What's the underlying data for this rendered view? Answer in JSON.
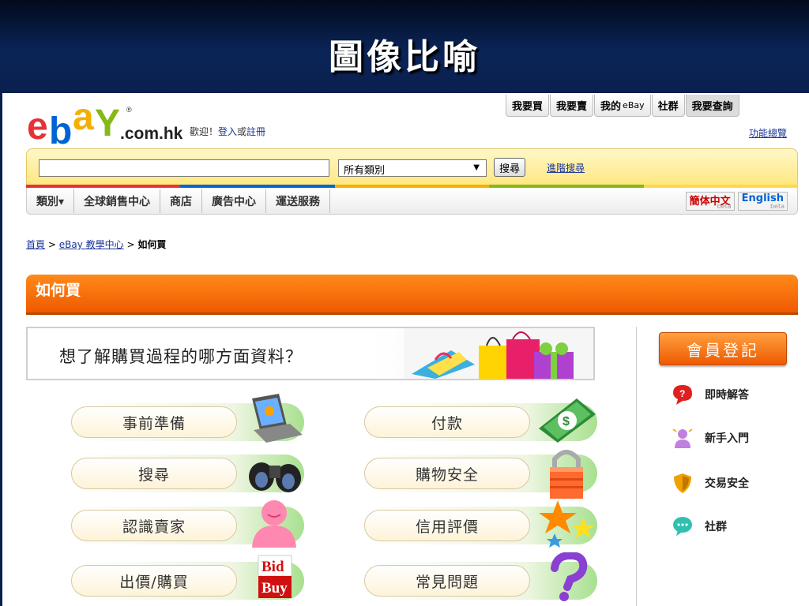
{
  "slide": {
    "title": "圖像比喻"
  },
  "header": {
    "logo_text": "ebay",
    "logo_domain": ".com.hk",
    "welcome_prefix": "歡迎！",
    "sign_in": "登入",
    "or": "或",
    "register": "註冊",
    "feature_link": "功能總覽",
    "top_tabs": [
      {
        "label": "我要買"
      },
      {
        "label": "我要賣"
      },
      {
        "label": "我的",
        "suffix": "eBay"
      },
      {
        "label": "社群"
      },
      {
        "label": "我要查詢"
      }
    ]
  },
  "search": {
    "input_value": "",
    "category": "所有類別",
    "search_button": "搜尋",
    "advanced_link": "進階搜尋"
  },
  "nav": {
    "items": [
      "類別▾",
      "全球銷售中心",
      "商店",
      "廣告中心",
      "運送服務"
    ],
    "lang_simplified": "簡体中文",
    "lang_english": "English",
    "beta": "beta"
  },
  "breadcrumb": {
    "home": "首頁",
    "learning": "eBay 教學中心",
    "current": "如何買",
    "sep": ">"
  },
  "section": {
    "title": "如何買"
  },
  "question": {
    "text": "想了解購買過程的哪方面資料？"
  },
  "topics": [
    {
      "label": "事前準備",
      "icon": "laptop-icon"
    },
    {
      "label": "付款",
      "icon": "money-icon"
    },
    {
      "label": "搜尋",
      "icon": "binoculars-icon"
    },
    {
      "label": "購物安全",
      "icon": "lock-icon"
    },
    {
      "label": "認識賣家",
      "icon": "person-icon"
    },
    {
      "label": "信用評價",
      "icon": "stars-icon"
    },
    {
      "label": "出價/購買",
      "icon": "bid-buy-icon",
      "icon_text": [
        "Bid",
        "Buy"
      ]
    },
    {
      "label": "常見問題",
      "icon": "question-icon"
    }
  ],
  "sidebar": {
    "register_button": "會員登記",
    "links": [
      {
        "label": "即時解答",
        "icon": "chat-bubble-icon"
      },
      {
        "label": "新手入門",
        "icon": "newcomer-icon"
      },
      {
        "label": "交易安全",
        "icon": "shield-icon"
      },
      {
        "label": "社群",
        "icon": "community-icon"
      }
    ]
  },
  "colors": {
    "ebay_red": "#e53238",
    "ebay_blue": "#0064d2",
    "ebay_yellow": "#f5af02",
    "ebay_green": "#86b817",
    "orange": "#f06000",
    "link": "#1a3399"
  }
}
